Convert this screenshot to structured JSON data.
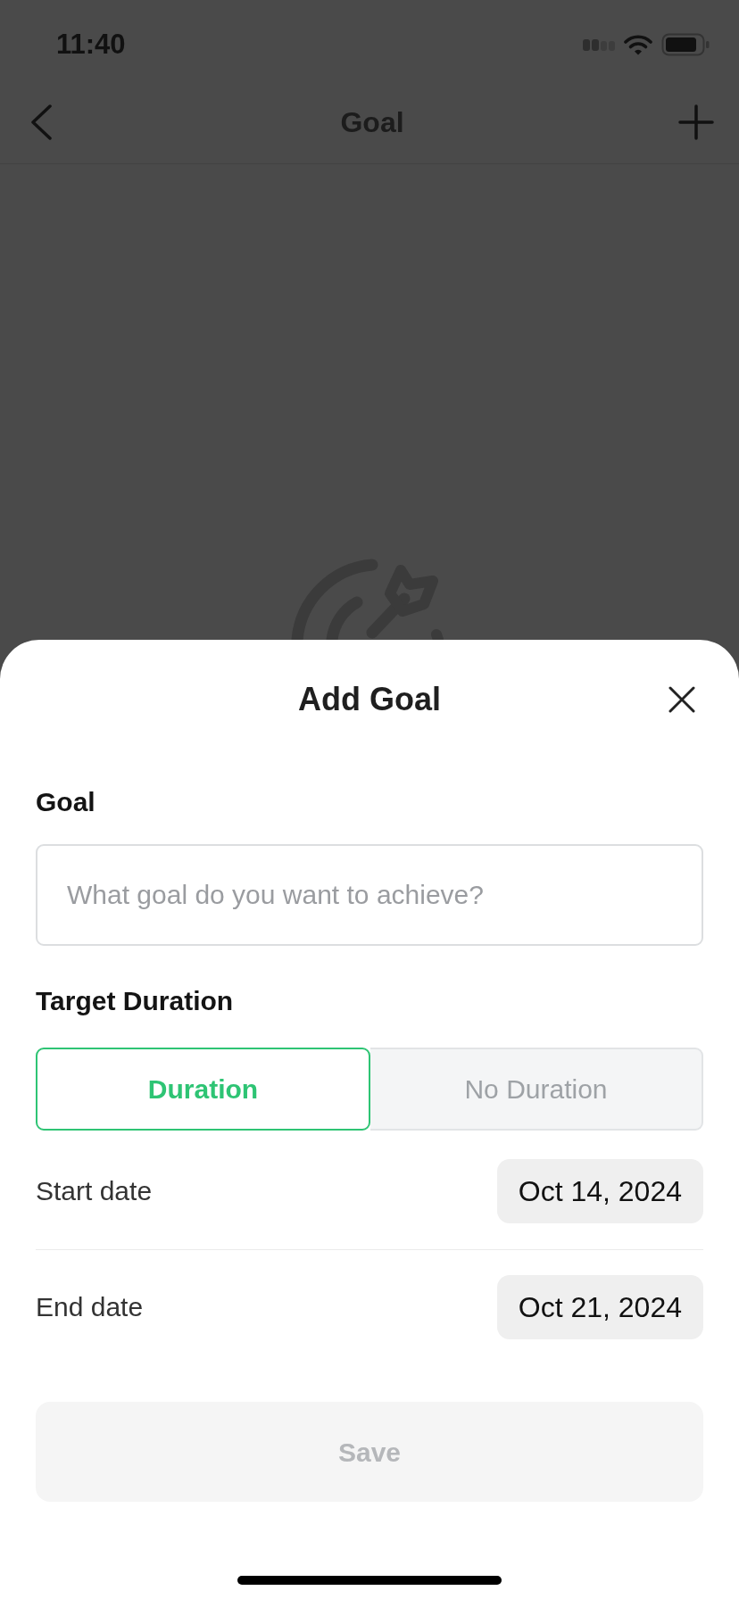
{
  "status_bar": {
    "time": "11:40"
  },
  "nav_bar": {
    "title": "Goal"
  },
  "sheet": {
    "title": "Add Goal",
    "goal_field": {
      "label": "Goal",
      "placeholder": "What goal do you want to achieve?"
    },
    "target_duration": {
      "label": "Target Duration",
      "options": [
        {
          "label": "Duration",
          "selected": true
        },
        {
          "label": "No Duration",
          "selected": false
        }
      ]
    },
    "dates": [
      {
        "label": "Start date",
        "value": "Oct 14, 2024"
      },
      {
        "label": "End date",
        "value": "Oct 21, 2024"
      }
    ],
    "save_button": {
      "label": "Save",
      "disabled": true
    }
  }
}
